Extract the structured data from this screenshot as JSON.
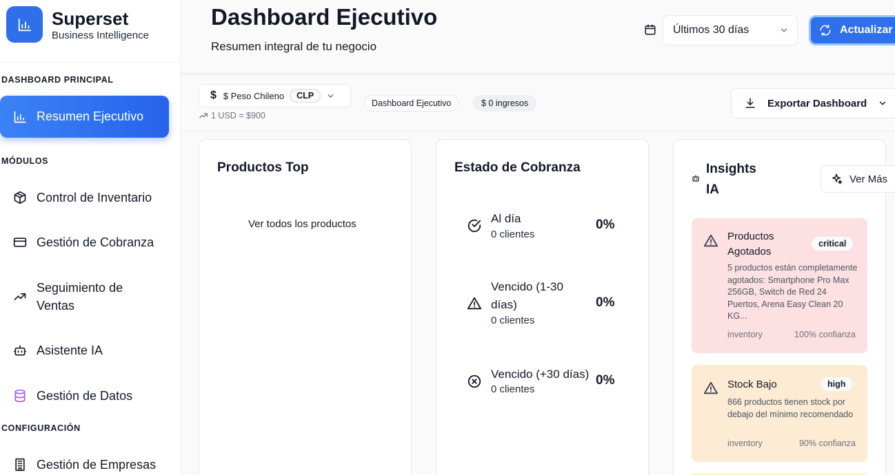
{
  "brand": {
    "name": "Superset",
    "subtitle": "Business Intelligence"
  },
  "sidebar": {
    "sections": {
      "main": "DASHBOARD PRINCIPAL",
      "modules": "MÓDULOS",
      "config": "CONFIGURACIÓN"
    },
    "items": [
      {
        "label": "Resumen Ejecutivo",
        "icon": "bar-chart-icon",
        "active": true
      },
      {
        "label": "Control de Inventario",
        "icon": "package-icon"
      },
      {
        "label": "Gestión de Cobranza",
        "icon": "credit-card-icon"
      },
      {
        "label": "Seguimiento de Ventas",
        "icon": "trending-up-icon"
      },
      {
        "label": "Asistente IA",
        "icon": "bot-icon"
      },
      {
        "label": "Gestión de Datos",
        "icon": "database-icon"
      },
      {
        "label": "Gestión de Empresas",
        "icon": "building-icon"
      }
    ]
  },
  "header": {
    "title": "Dashboard Ejecutivo",
    "subtitle": "Resumen integral de tu negocio",
    "date_range": "Últimos 30 días",
    "refresh_label": "Actualizar"
  },
  "toolbar": {
    "currency_symbol": "$",
    "currency_name": "$ Peso Chileno",
    "currency_code": "CLP",
    "exchange_rate": "1 USD = $900",
    "badge_dashboard": "Dashboard Ejecutivo",
    "badge_income": "$ 0 ingresos",
    "export_label": "Exportar Dashboard"
  },
  "products_card": {
    "title": "Productos Top",
    "link": "Ver todos los productos"
  },
  "collections_card": {
    "title": "Estado de Cobranza",
    "rows": [
      {
        "label": "Al día",
        "sub": "0 clientes",
        "pct": "0%"
      },
      {
        "label_line1": "Vencido (1-30",
        "label_line2": "días)",
        "sub": "0 clientes",
        "pct": "0%"
      },
      {
        "label": "Vencido (+30 días)",
        "sub": "0 clientes",
        "pct": "0%"
      }
    ]
  },
  "insights_card": {
    "title_line1": "Insights",
    "title_line2": "IA",
    "more_label": "Ver Más",
    "items": [
      {
        "title_line1": "Productos",
        "title_line2": "Agotados",
        "badge": "critical",
        "desc": "5 productos están completamente agotados: Smartphone Pro Max 256GB, Switch de Red 24 Puertos, Arena Easy Clean 20 KG...",
        "category": "inventory",
        "confidence": "100% confianza",
        "color": "#fde0e1"
      },
      {
        "title": "Stock Bajo",
        "badge": "high",
        "desc": "866 productos tienen stock por debajo del mínimo recomendado",
        "category": "inventory",
        "confidence": "90% confianza",
        "color": "#fdebd3"
      }
    ]
  },
  "colors": {
    "primary": "#2f6fea",
    "critical_bg": "#fde0e1",
    "high_bg": "#fdebd3"
  }
}
